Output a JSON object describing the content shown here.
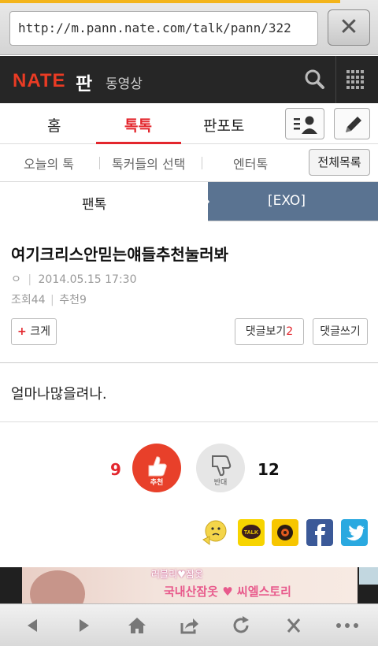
{
  "browser": {
    "url": "http://m.pann.nate.com/talk/pann/322",
    "load_progress": 0.9
  },
  "header": {
    "logo": "NATE",
    "section": "판",
    "video_link": "동영상"
  },
  "main_tabs": [
    {
      "label": "홈",
      "active": false
    },
    {
      "label": "톡톡",
      "active": true
    },
    {
      "label": "판포토",
      "active": false
    }
  ],
  "sub_tabs": [
    {
      "label": "오늘의 톡"
    },
    {
      "label": "톡커들의 선택"
    },
    {
      "label": "엔터톡"
    }
  ],
  "all_list_label": "전체목록",
  "breadcrumb": {
    "left": "팬톡",
    "right": "[EXO]"
  },
  "post": {
    "title": "여기크리스안믿는얘들추천눌러봐",
    "author": "ㅇ",
    "date": "2014.05.15 17:30",
    "views_label": "조회44",
    "recommend_label": "추천9",
    "enlarge_label": "크게",
    "comments_label": "댓글보기",
    "comments_count": "2",
    "write_comment_label": "댓글쓰기",
    "body": "얼마나많을려나."
  },
  "votes": {
    "up_count": "9",
    "up_label": "추천",
    "down_label": "반대",
    "down_count": "12"
  },
  "share": [
    "emoticon-icon",
    "kakaotalk-icon",
    "kakaostory-icon",
    "facebook-icon",
    "twitter-icon"
  ],
  "ad": {
    "line1": "러블리♥잠옷",
    "line2": "국내산잠옷 ♥ 씨엘스토리"
  },
  "colors": {
    "accent_red": "#e3262d",
    "header_dark": "#262626",
    "breadcrumb_blue": "#5a7391"
  }
}
